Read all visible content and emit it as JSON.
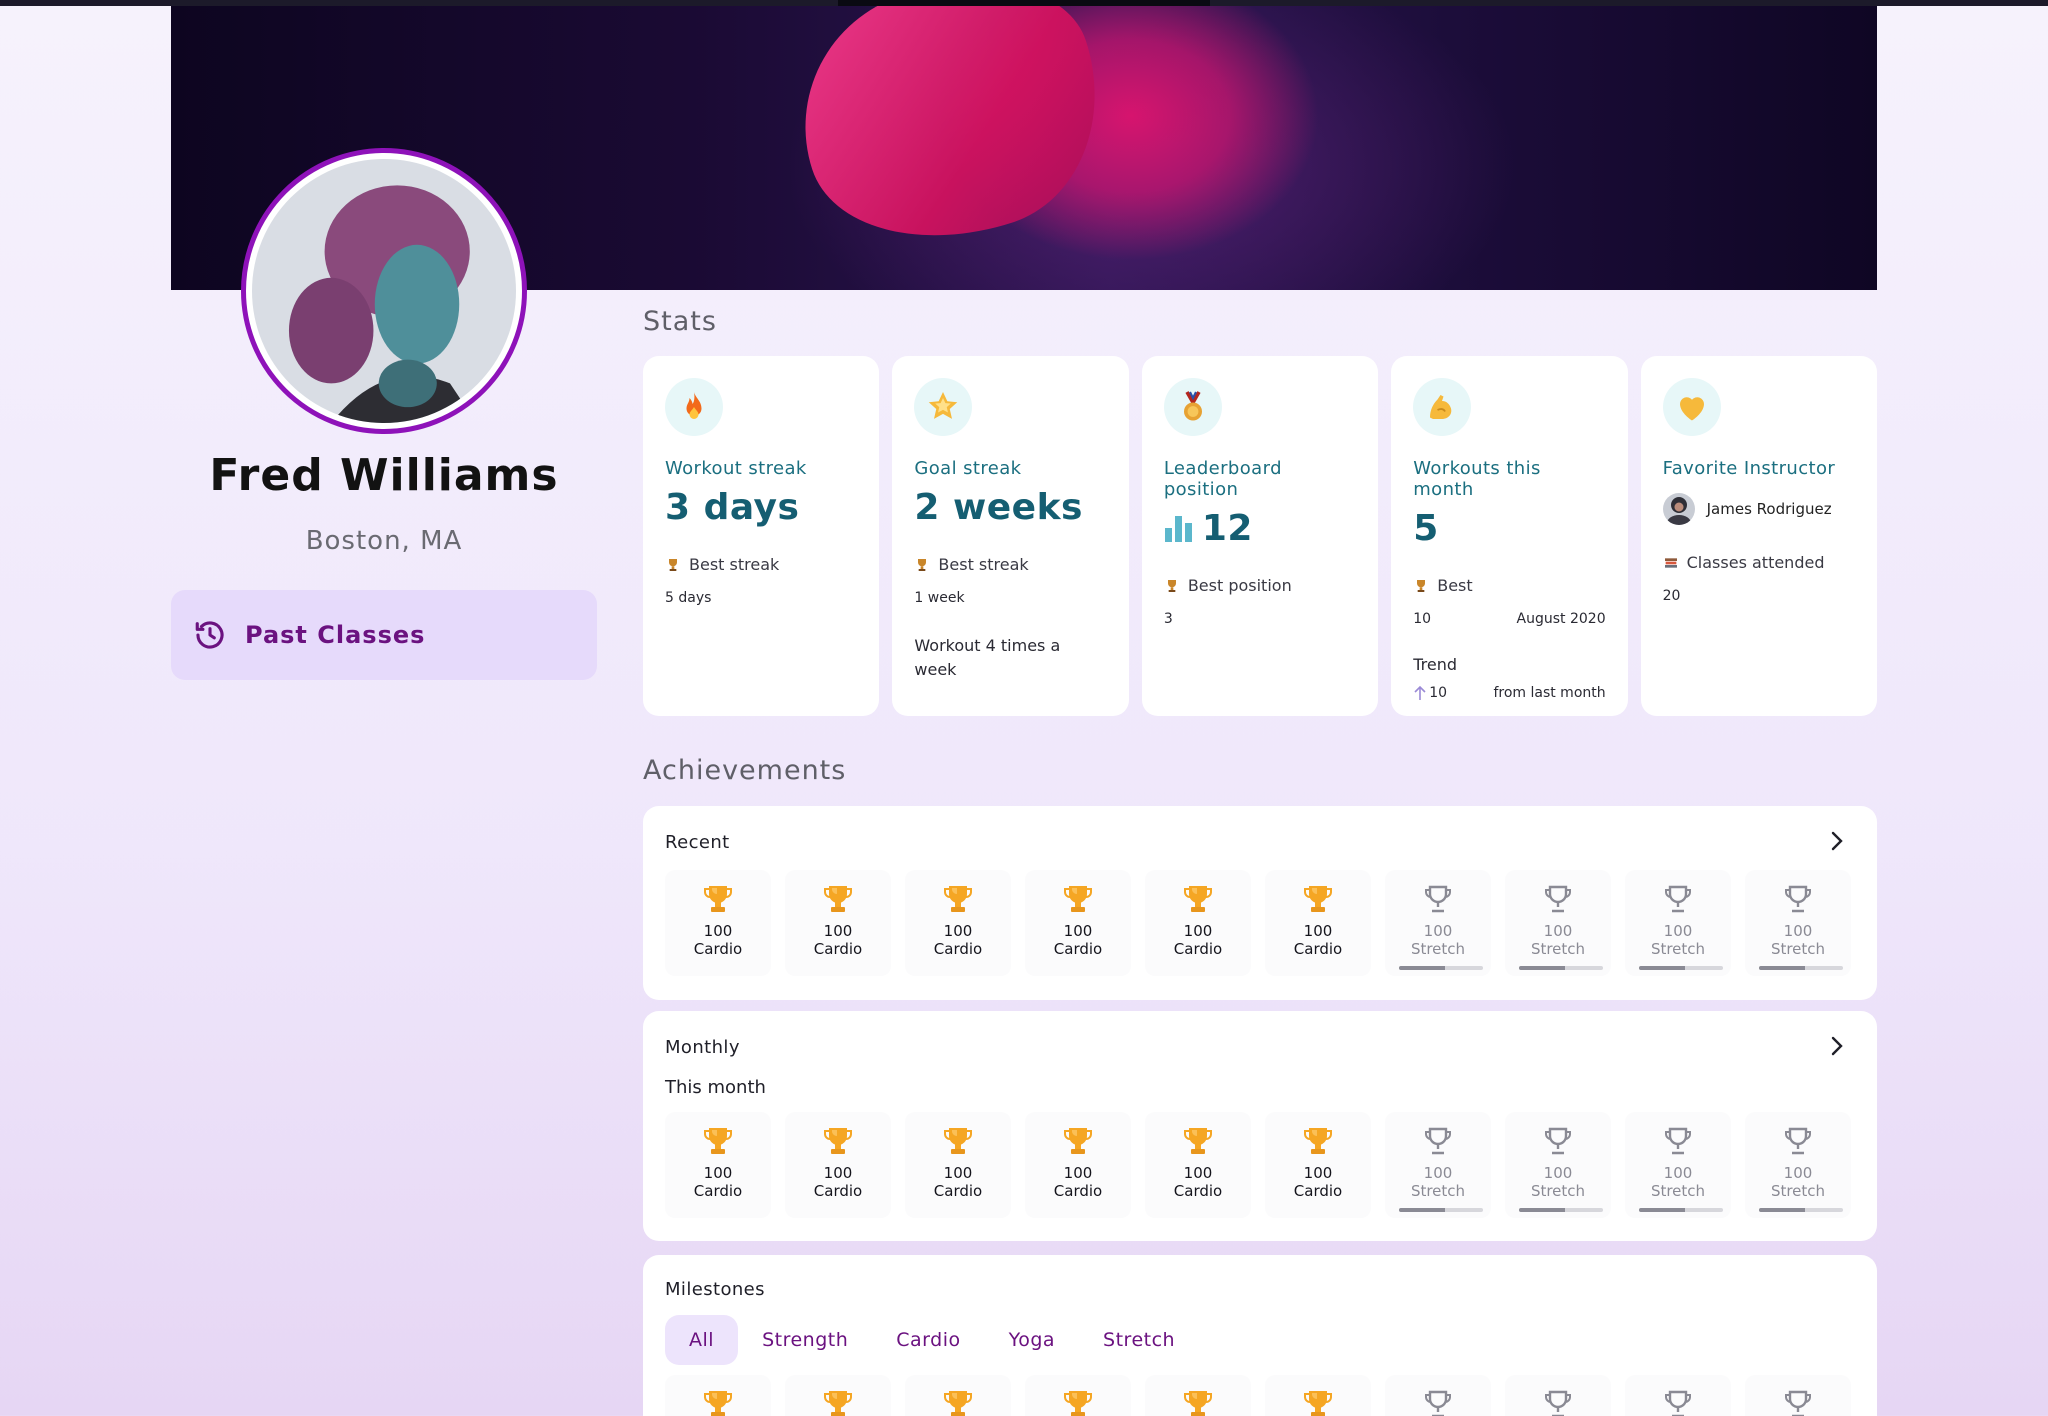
{
  "profile": {
    "name": "Fred Williams",
    "location": "Boston, MA",
    "past_classes_label": "Past Classes"
  },
  "colors": {
    "accent": "#6b1280",
    "avatar_ring": "#8e12b9",
    "stat_text": "#155e72",
    "trophy_gold": "#f5a623",
    "trophy_locked": "#8a8a94"
  },
  "stats": {
    "title": "Stats",
    "cards": [
      {
        "icon": "fire-icon",
        "label": "Workout streak",
        "value": "3 days",
        "best_label": "Best streak",
        "best_value": "5 days"
      },
      {
        "icon": "star-icon",
        "label": "Goal streak",
        "value": "2 weeks",
        "best_label": "Best streak",
        "best_value": "1 week",
        "note": "Workout 4 times a week"
      },
      {
        "icon": "medal-icon",
        "label": "Leaderboard position",
        "value": "12",
        "best_label": "Best position",
        "best_value": "3"
      },
      {
        "icon": "flexed-arm-icon",
        "label": "Workouts this month",
        "value": "5",
        "best_label": "Best",
        "best_value": "10",
        "best_date": "August 2020",
        "trend_label": "Trend",
        "trend_value": "10",
        "trend_note": "from last month"
      },
      {
        "icon": "heart-icon",
        "label": "Favorite Instructor",
        "instructor": "James Rodriguez",
        "attended_label": "Classes attended",
        "attended_value": "20"
      }
    ]
  },
  "achievements": {
    "title": "Achievements",
    "recent": {
      "label": "Recent",
      "badges": [
        {
          "value": "100",
          "category": "Cardio",
          "earned": true
        },
        {
          "value": "100",
          "category": "Cardio",
          "earned": true
        },
        {
          "value": "100",
          "category": "Cardio",
          "earned": true
        },
        {
          "value": "100",
          "category": "Cardio",
          "earned": true
        },
        {
          "value": "100",
          "category": "Cardio",
          "earned": true
        },
        {
          "value": "100",
          "category": "Cardio",
          "earned": true
        },
        {
          "value": "100",
          "category": "Stretch",
          "earned": false,
          "progress": 0.55
        },
        {
          "value": "100",
          "category": "Stretch",
          "earned": false,
          "progress": 0.55
        },
        {
          "value": "100",
          "category": "Stretch",
          "earned": false,
          "progress": 0.55
        },
        {
          "value": "100",
          "category": "Stretch",
          "earned": false,
          "progress": 0.55
        }
      ]
    },
    "monthly": {
      "label": "Monthly",
      "sublabel": "This month",
      "badges": [
        {
          "value": "100",
          "category": "Cardio",
          "earned": true
        },
        {
          "value": "100",
          "category": "Cardio",
          "earned": true
        },
        {
          "value": "100",
          "category": "Cardio",
          "earned": true
        },
        {
          "value": "100",
          "category": "Cardio",
          "earned": true
        },
        {
          "value": "100",
          "category": "Cardio",
          "earned": true
        },
        {
          "value": "100",
          "category": "Cardio",
          "earned": true
        },
        {
          "value": "100",
          "category": "Stretch",
          "earned": false,
          "progress": 0.55
        },
        {
          "value": "100",
          "category": "Stretch",
          "earned": false,
          "progress": 0.55
        },
        {
          "value": "100",
          "category": "Stretch",
          "earned": false,
          "progress": 0.55
        },
        {
          "value": "100",
          "category": "Stretch",
          "earned": false,
          "progress": 0.55
        }
      ]
    },
    "milestones": {
      "label": "Milestones",
      "tabs": [
        "All",
        "Strength",
        "Cardio",
        "Yoga",
        "Stretch"
      ],
      "active_tab": "All",
      "badges_earned": [
        true,
        true,
        true,
        true,
        true,
        true,
        false,
        false,
        false,
        false
      ]
    }
  }
}
